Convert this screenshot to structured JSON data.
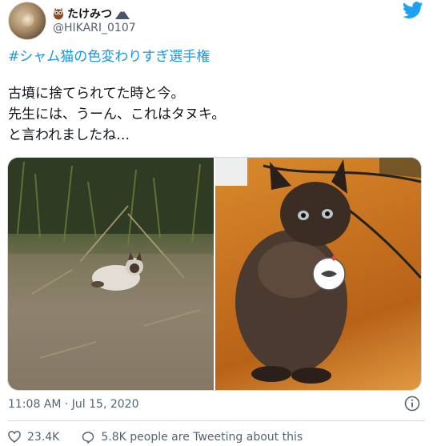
{
  "tweet": {
    "display_name": "たけみつ",
    "handle": "@HIKARI_0107",
    "hashtag": "#シャム猫の色変わりすぎ選手権",
    "text_lines": [
      "古墳に捨てられてた時と今。",
      "先生には、うーん、これはタヌキ。",
      "と言われましたね…"
    ],
    "timestamp": "11:08 AM · Jul 15, 2020",
    "like_count": "23.4K",
    "tweeting_about": "5.8K people are Tweeting about this"
  },
  "icons": {
    "owl": "owl-icon",
    "mountain": "mountain-icon",
    "bird": "twitter-bird-icon",
    "info": "info-icon",
    "heart": "heart-icon",
    "reply": "reply-bubble-icon"
  },
  "colors": {
    "link": "#1b95e0",
    "brand": "#1da1f2",
    "muted": "#536471",
    "border": "#cfd9de"
  }
}
